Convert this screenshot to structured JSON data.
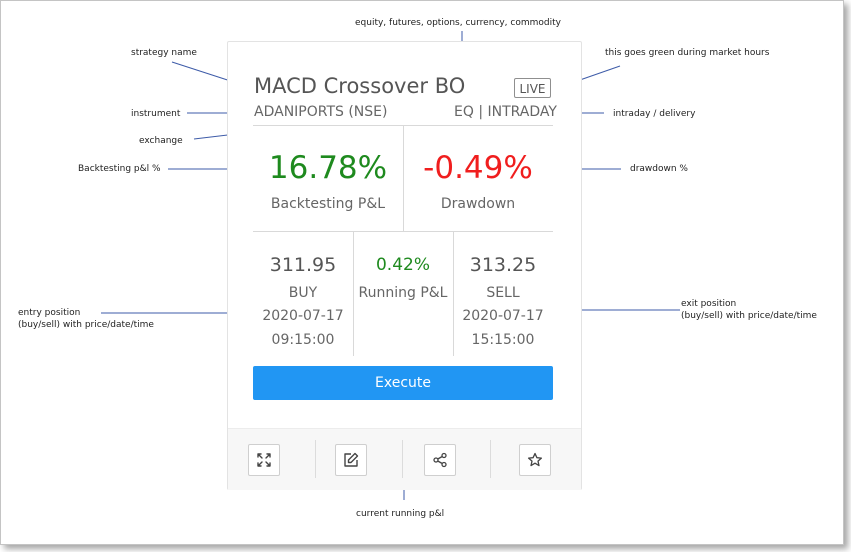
{
  "strategy": {
    "name": "MACD Crossover BO",
    "status_badge": "LIVE",
    "instrument": "ADANIPORTS (NSE)",
    "segment": "EQ | INTRADAY"
  },
  "metrics": {
    "backtesting_value": "16.78%",
    "backtesting_label": "Backtesting P&L",
    "drawdown_value": "-0.49%",
    "drawdown_label": "Drawdown"
  },
  "entry": {
    "price": "311.95",
    "side": "BUY",
    "date": "2020-07-17",
    "time": "09:15:00"
  },
  "running": {
    "value": "0.42%",
    "label": "Running P&L"
  },
  "exit": {
    "price": "313.25",
    "side": "SELL",
    "date": "2020-07-17",
    "time": "15:15:00"
  },
  "actions": {
    "execute_label": "Execute"
  },
  "footer_icons": [
    "expand-icon",
    "edit-icon",
    "share-icon",
    "star-icon"
  ],
  "annotations": {
    "equity": "equity, futures, options, currency, commodity",
    "strategy_name": "strategy name",
    "market_hours": "this goes green during market hours",
    "instrument": "instrument",
    "intraday": "intraday / delivery",
    "exchange": "exchange",
    "backtesting": "Backtesting p&l %",
    "drawdown": "drawdown %",
    "entry_line1": "entry position",
    "entry_line2": "(buy/sell) with price/date/time",
    "exit_line1": "exit position",
    "exit_line2": "(buy/sell) with price/date/time",
    "current": "current running p&l"
  },
  "colors": {
    "positive": "#1e8a1e",
    "negative": "#f01e1e",
    "accent": "#2196f3"
  }
}
